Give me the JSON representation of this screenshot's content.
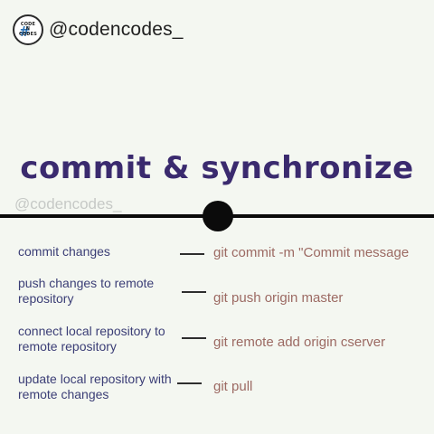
{
  "header": {
    "logo_lines": [
      "CODE",
      "N",
      "CODES"
    ],
    "logo_symbol": "#",
    "handle": "@codencodes_"
  },
  "title": "commit & synchronize",
  "watermark": "@codencodes_",
  "rows": [
    {
      "description": "commit changes",
      "command": "git commit -m \"Commit message"
    },
    {
      "description": "push changes to remote repository",
      "command": "git push origin master"
    },
    {
      "description": "connect local repository to remote repository",
      "command": "git remote add origin cserver"
    },
    {
      "description": "update local repository with remote changes",
      "command": "git pull"
    }
  ],
  "colors": {
    "background": "#f4f7f1",
    "title": "#3a2a6e",
    "description": "#3b3e76",
    "command": "#9c6a63",
    "divider": "#0b0b0b",
    "logo_hash": "#2a73b8"
  }
}
